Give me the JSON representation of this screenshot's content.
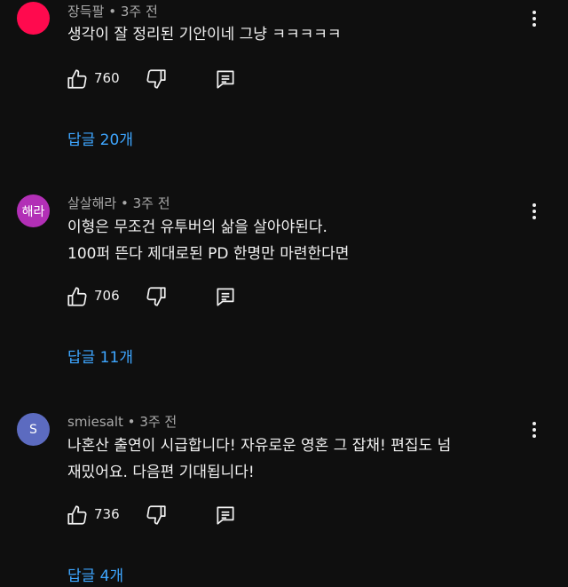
{
  "comments": [
    {
      "author": "장득팔",
      "time": "3주 전",
      "avatar_color": "#ff0a4e",
      "avatar_text": "",
      "lines": [
        "생각이 잘 정리된 기안이네 그냥 ㅋㅋㅋㅋㅋ"
      ],
      "likes": "760",
      "replies_label": "답글 20개"
    },
    {
      "author": "살살해라",
      "time": "3주 전",
      "avatar_color": "#b22fb6",
      "avatar_text": "해라",
      "lines": [
        "이형은 무조건 유투버의 삶을 살아야된다.",
        "100퍼 뜬다 제대로된 PD 한명만 마련한다면"
      ],
      "likes": "706",
      "replies_label": "답글 11개"
    },
    {
      "author": "smiesalt",
      "time": "3주 전",
      "avatar_color": "#5c6bc0",
      "avatar_text": "S",
      "lines": [
        "나혼산 출연이 시급합니다! 자유로운 영혼 그 잡채! 편집도 넘",
        "재밌어요. 다음편 기대됩니다!"
      ],
      "likes": "736",
      "replies_label": "답글 4개"
    }
  ],
  "separator": "•",
  "icons": {
    "like": "thumbs-up-icon",
    "dislike": "thumbs-down-icon",
    "reply": "reply-comment-icon",
    "more": "more-vert-icon"
  },
  "colors": {
    "background": "#0f0f0f",
    "text": "#f1f1f1",
    "meta": "#aaaaaa",
    "link": "#3ea6ff"
  }
}
